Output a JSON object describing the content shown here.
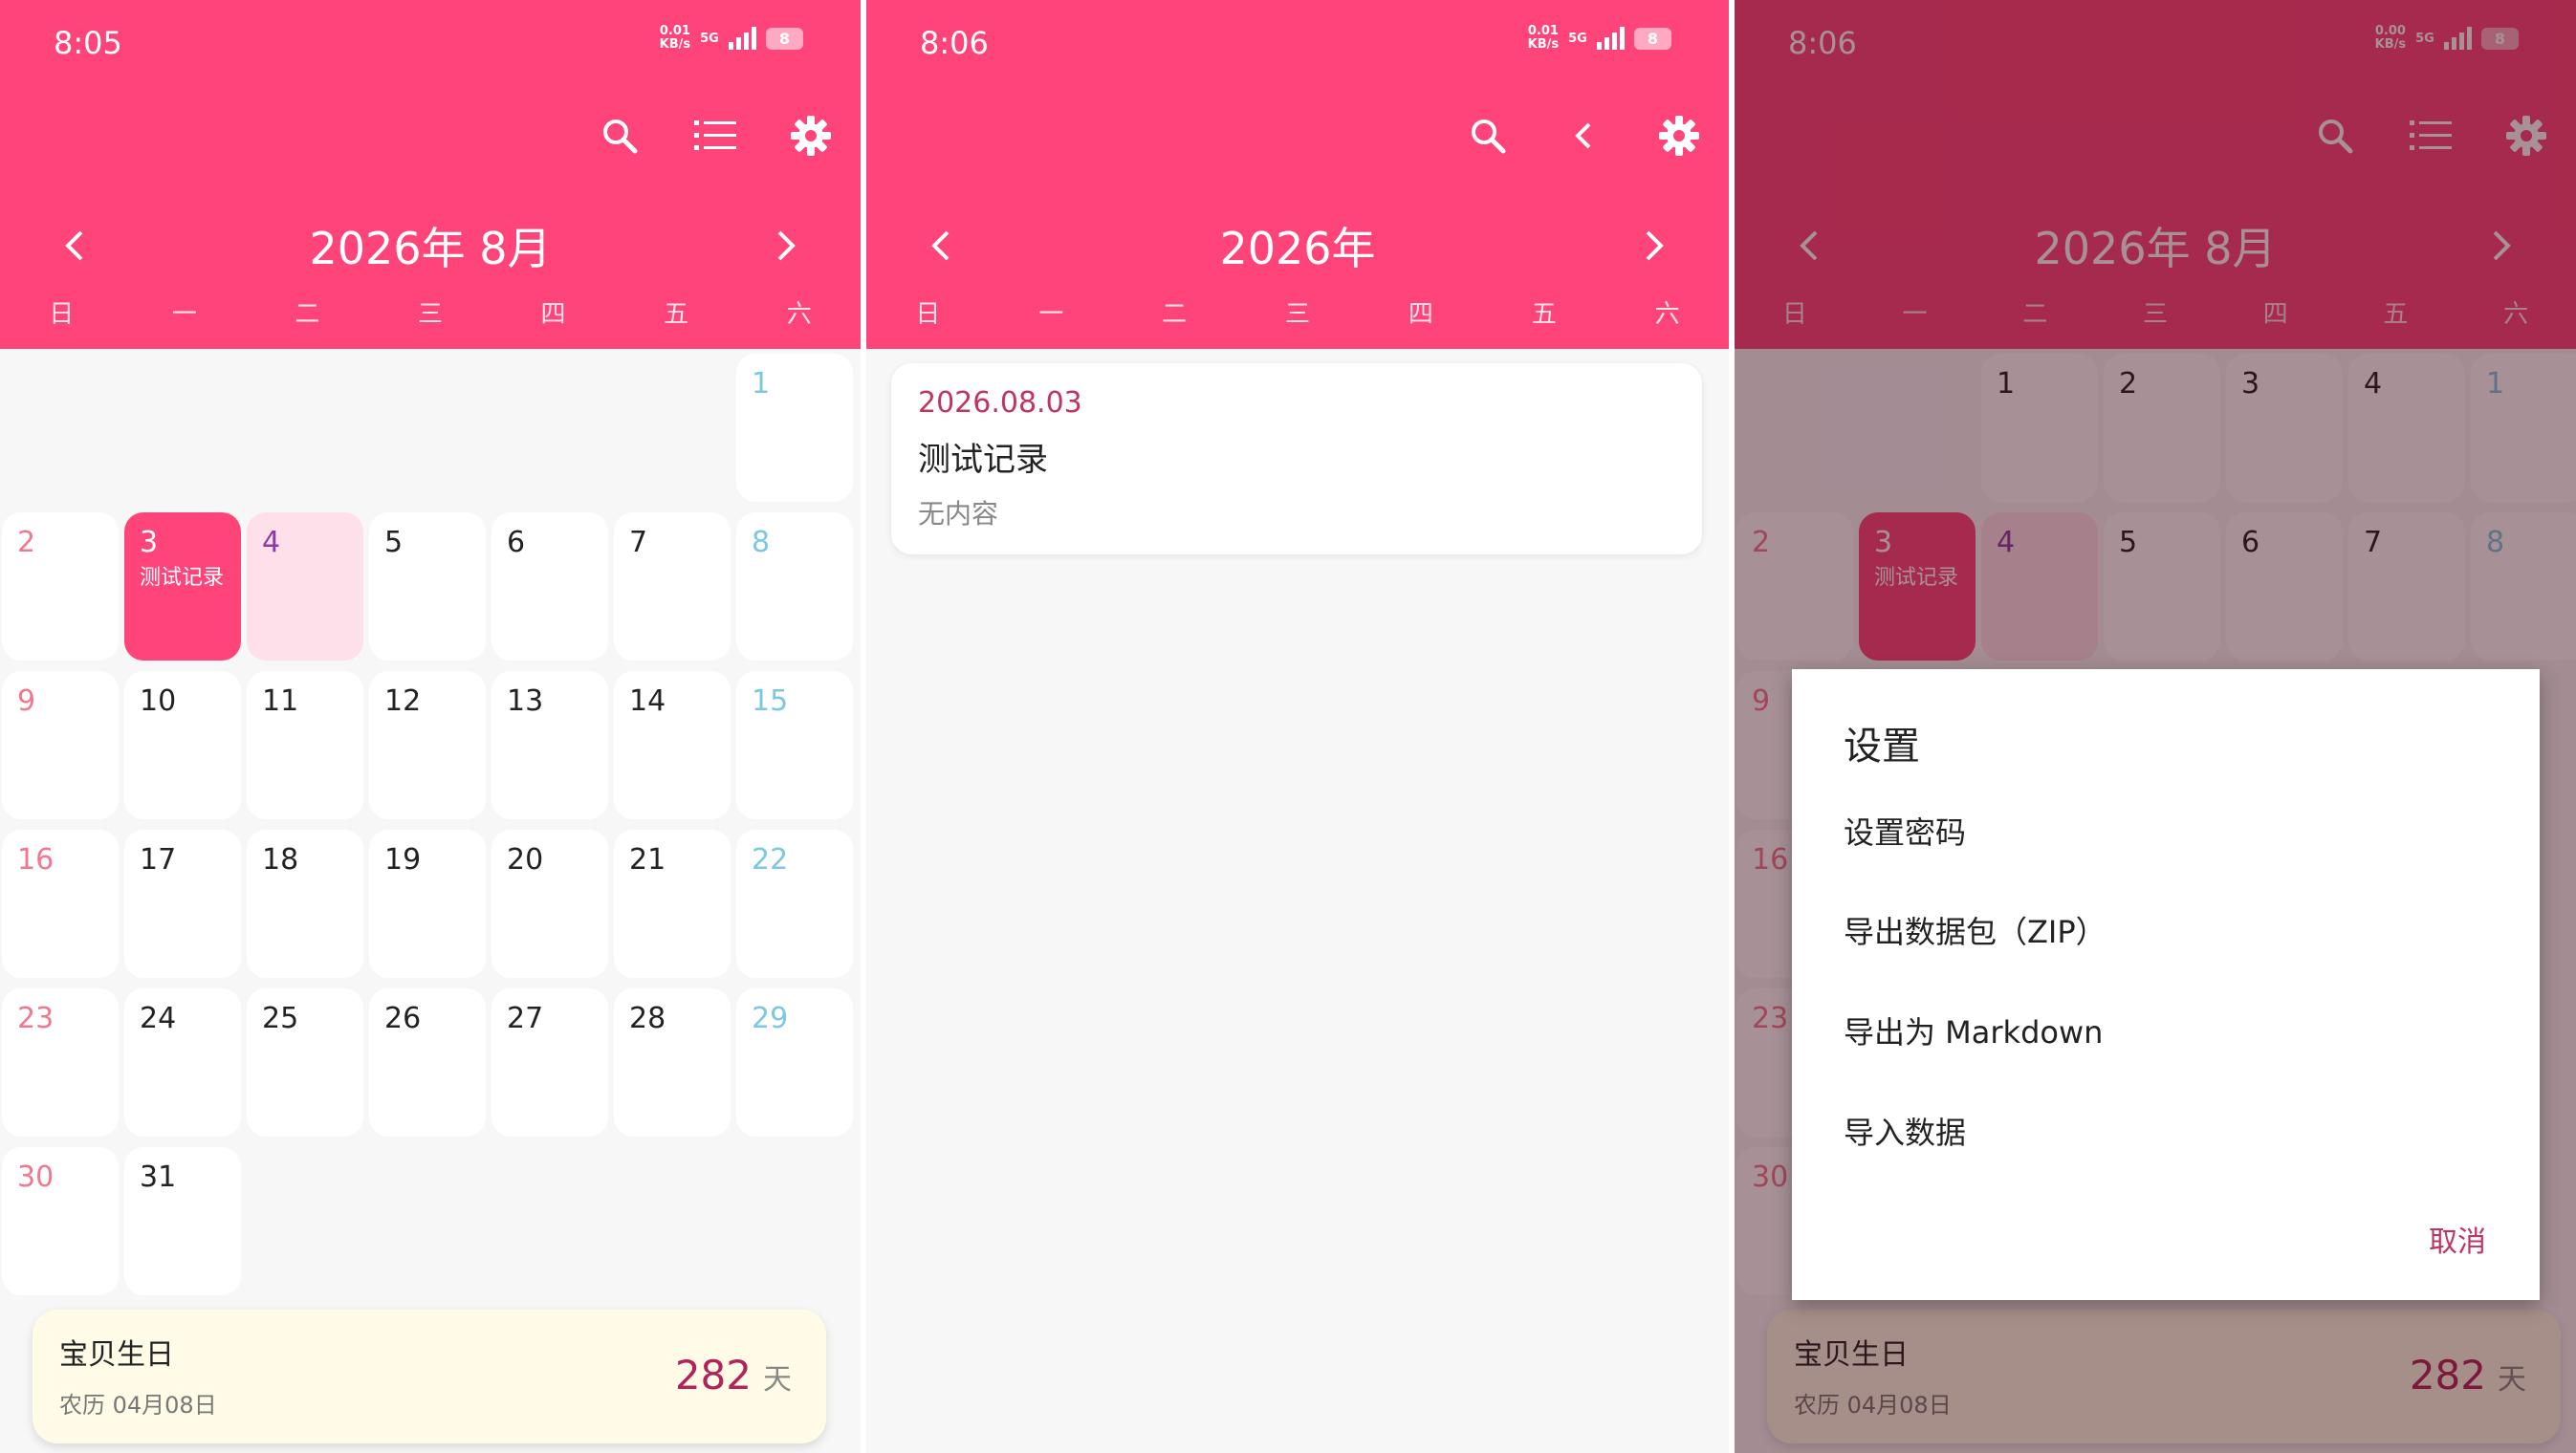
{
  "colors": {
    "accent": "#fe4478",
    "accent_dark": "#b0245a",
    "sunday": "#f0788f",
    "saturday": "#7cc7e2",
    "today_bg": "#fde0ea"
  },
  "panel1": {
    "status": {
      "time": "8:05",
      "speed": "0.01",
      "speed_unit": "KB/s",
      "net": "5G",
      "battery": "8"
    },
    "toolbar": {
      "icons": [
        "search-icon",
        "list-icon",
        "gear-icon"
      ]
    },
    "month_title": "2026年 8月",
    "weekdays": [
      "日",
      "一",
      "二",
      "三",
      "四",
      "五",
      "六"
    ],
    "days": [
      {
        "d": "1",
        "row": 0,
        "col": 6
      },
      {
        "d": "2",
        "row": 1,
        "col": 0
      },
      {
        "d": "3",
        "row": 1,
        "col": 1,
        "event": "测试记录"
      },
      {
        "d": "4",
        "row": 1,
        "col": 2
      },
      {
        "d": "5",
        "row": 1,
        "col": 3
      },
      {
        "d": "6",
        "row": 1,
        "col": 4
      },
      {
        "d": "7",
        "row": 1,
        "col": 5
      },
      {
        "d": "8",
        "row": 1,
        "col": 6
      },
      {
        "d": "9",
        "row": 2,
        "col": 0
      },
      {
        "d": "10",
        "row": 2,
        "col": 1
      },
      {
        "d": "11",
        "row": 2,
        "col": 2
      },
      {
        "d": "12",
        "row": 2,
        "col": 3
      },
      {
        "d": "13",
        "row": 2,
        "col": 4
      },
      {
        "d": "14",
        "row": 2,
        "col": 5
      },
      {
        "d": "15",
        "row": 2,
        "col": 6
      },
      {
        "d": "16",
        "row": 3,
        "col": 0
      },
      {
        "d": "17",
        "row": 3,
        "col": 1
      },
      {
        "d": "18",
        "row": 3,
        "col": 2
      },
      {
        "d": "19",
        "row": 3,
        "col": 3
      },
      {
        "d": "20",
        "row": 3,
        "col": 4
      },
      {
        "d": "21",
        "row": 3,
        "col": 5
      },
      {
        "d": "22",
        "row": 3,
        "col": 6
      },
      {
        "d": "23",
        "row": 4,
        "col": 0
      },
      {
        "d": "24",
        "row": 4,
        "col": 1
      },
      {
        "d": "25",
        "row": 4,
        "col": 2
      },
      {
        "d": "26",
        "row": 4,
        "col": 3
      },
      {
        "d": "27",
        "row": 4,
        "col": 4
      },
      {
        "d": "28",
        "row": 4,
        "col": 5
      },
      {
        "d": "29",
        "row": 4,
        "col": 6
      },
      {
        "d": "30",
        "row": 5,
        "col": 0
      },
      {
        "d": "31",
        "row": 5,
        "col": 1
      }
    ],
    "selected_day": "3",
    "today_day": "4",
    "anniversary": {
      "name": "宝贝生日",
      "lunar": "农历 04月08日",
      "count": "282",
      "unit": "天"
    }
  },
  "panel2": {
    "status": {
      "time": "8:06",
      "speed": "0.01",
      "speed_unit": "KB/s",
      "net": "5G",
      "battery": "8"
    },
    "year_title": "2026年",
    "weekdays": [
      "日",
      "一",
      "二",
      "三",
      "四",
      "五",
      "六"
    ],
    "record": {
      "date": "2026.08.03",
      "title": "测试记录",
      "content": "无内容"
    }
  },
  "panel3": {
    "status": {
      "time": "8:06",
      "speed": "0.00",
      "speed_unit": "KB/s",
      "net": "5G",
      "battery": "8"
    },
    "month_title": "2026年 8月",
    "weekdays": [
      "日",
      "一",
      "二",
      "三",
      "四",
      "五",
      "六"
    ],
    "bg_days": [
      {
        "d": "1",
        "row": 0,
        "col": 2
      },
      {
        "d": "2",
        "row": 0,
        "col": 3
      },
      {
        "d": "3",
        "row": 0,
        "col": 4
      },
      {
        "d": "4",
        "row": 0,
        "col": 5
      },
      {
        "d": "1",
        "row": 0,
        "col": 6
      },
      {
        "d": "2",
        "row": 1,
        "col": 0
      },
      {
        "d": "3",
        "row": 1,
        "col": 1,
        "event": "测试记录"
      },
      {
        "d": "4",
        "row": 1,
        "col": 2
      },
      {
        "d": "5",
        "row": 1,
        "col": 3
      },
      {
        "d": "6",
        "row": 1,
        "col": 4
      },
      {
        "d": "7",
        "row": 1,
        "col": 5
      },
      {
        "d": "8",
        "row": 1,
        "col": 6
      },
      {
        "d": "9",
        "row": 2,
        "col": 0
      },
      {
        "d": "16",
        "row": 3,
        "col": 0
      },
      {
        "d": "23",
        "row": 4,
        "col": 0
      },
      {
        "d": "30",
        "row": 5,
        "col": 0
      }
    ],
    "dialog": {
      "title": "设置",
      "options": [
        "设置密码",
        "导出数据包（ZIP）",
        "导出为 Markdown",
        "导入数据"
      ],
      "cancel": "取消"
    },
    "anniversary": {
      "name": "宝贝生日",
      "lunar": "农历 04月08日",
      "count": "282",
      "unit": "天"
    }
  }
}
